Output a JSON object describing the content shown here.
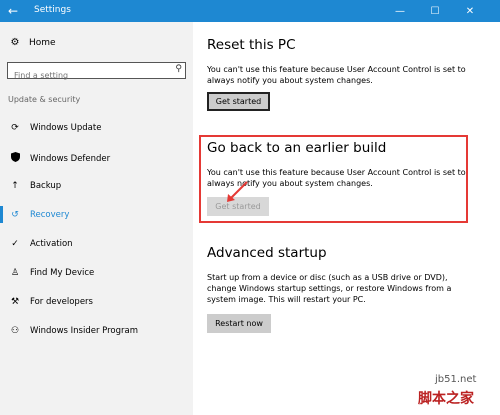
{
  "window": {
    "title": "Settings",
    "back": "←",
    "minimize": "—",
    "maximize": "☐",
    "close": "✕"
  },
  "sidebar": {
    "home": "Home",
    "search_placeholder": "Find a setting",
    "section": "Update & security",
    "items": [
      {
        "label": "Windows Update",
        "icon": "sync-icon"
      },
      {
        "label": "Windows Defender",
        "icon": "shield-icon"
      },
      {
        "label": "Backup",
        "icon": "backup-arrow-icon"
      },
      {
        "label": "Recovery",
        "icon": "recovery-icon",
        "active": true
      },
      {
        "label": "Activation",
        "icon": "check-circle-icon"
      },
      {
        "label": "Find My Device",
        "icon": "person-icon"
      },
      {
        "label": "For developers",
        "icon": "developer-icon"
      },
      {
        "label": "Windows Insider Program",
        "icon": "insider-icon"
      }
    ]
  },
  "reset": {
    "title": "Reset this PC",
    "desc": "You can't use this feature because User Account Control is set to always notify you about system changes.",
    "button": "Get started"
  },
  "goback": {
    "title": "Go back to an earlier build",
    "desc": "You can't use this feature because User Account Control is set to always notify you about system changes.",
    "button": "Get started"
  },
  "advanced": {
    "title": "Advanced startup",
    "desc": "Start up from a device or disc (such as a USB drive or DVD), change Windows startup settings, or restore Windows from a system image. This will restart your PC.",
    "button": "Restart now"
  },
  "watermark": {
    "site": "jb51.net",
    "brand": "脚本之家"
  },
  "colors": {
    "accent": "#1e88d2",
    "highlight": "#e53935"
  }
}
